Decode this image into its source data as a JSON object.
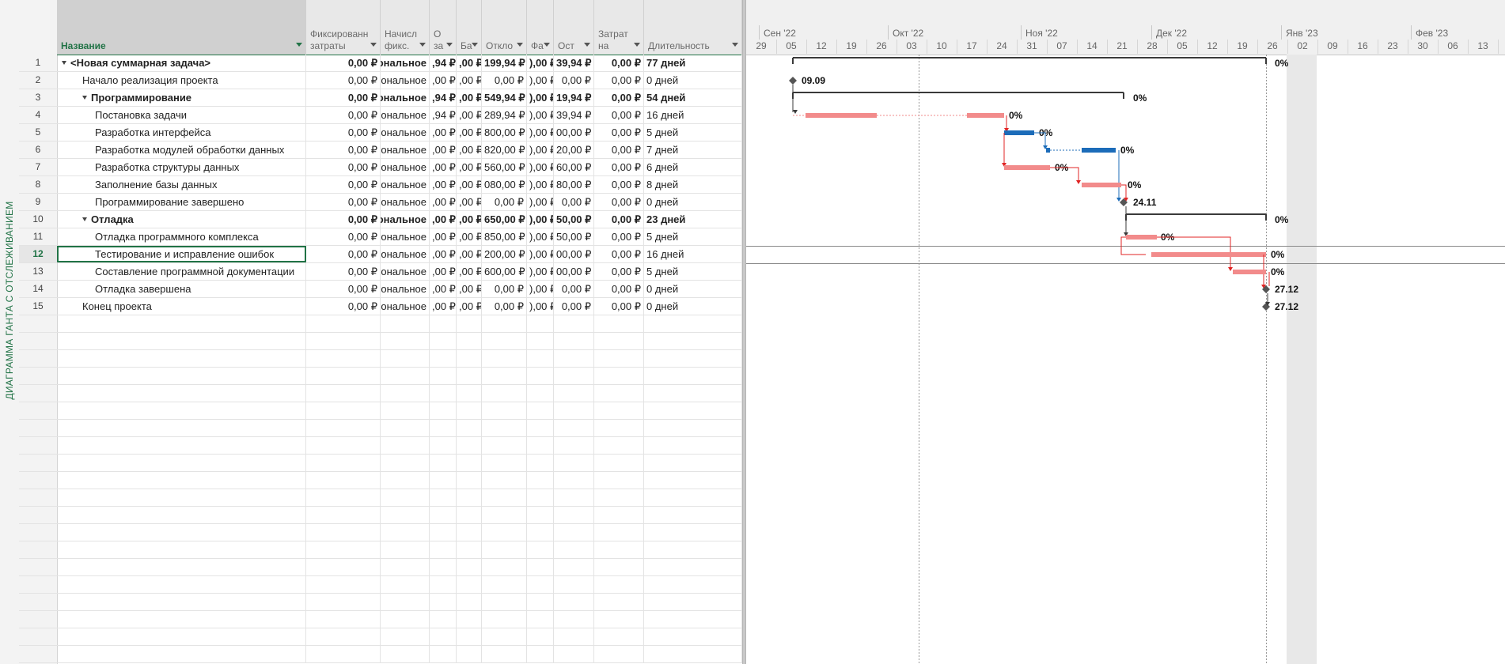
{
  "view": {
    "label": "ДИАГРАММА ГАНТА С ОТСЛЕЖИВАНИЕМ"
  },
  "table": {
    "columns": [
      {
        "key": "name",
        "l1": "",
        "l2": "Название"
      },
      {
        "key": "fixed_cost",
        "l1": "Фиксированн",
        "l2": "затраты"
      },
      {
        "key": "accrual",
        "l1": "Начисл",
        "l2": "фикс."
      },
      {
        "key": "total_cost",
        "l1": "О",
        "l2": "за"
      },
      {
        "key": "baseline",
        "l1": "",
        "l2": "Ба"
      },
      {
        "key": "variance",
        "l1": "",
        "l2": "Откло"
      },
      {
        "key": "actual",
        "l1": "",
        "l2": "Фа"
      },
      {
        "key": "remaining",
        "l1": "",
        "l2": "Ост"
      },
      {
        "key": "cost_per",
        "l1": "Затрат",
        "l2": "на"
      },
      {
        "key": "duration",
        "l1": "",
        "l2": "Длительность"
      }
    ],
    "rows": [
      {
        "id": "1",
        "name": "<Новая суммарная задача>",
        "level": 0,
        "summary": true,
        "cells": [
          "0,00 ₽",
          "ональное",
          ",94 ₽",
          ",00 ₽",
          "199,94 ₽",
          "),00 ₽",
          "39,94 ₽",
          "0,00 ₽",
          "77 дней"
        ]
      },
      {
        "id": "2",
        "name": "Начало реализация проекта",
        "level": 1,
        "summary": false,
        "cells": [
          "0,00 ₽",
          "ональное",
          ",00 ₽",
          ",00 ₽",
          "0,00 ₽",
          "),00 ₽",
          "0,00 ₽",
          "0,00 ₽",
          "0 дней"
        ]
      },
      {
        "id": "3",
        "name": "Программирование",
        "level": 1,
        "summary": true,
        "cells": [
          "0,00 ₽",
          "ональное",
          ",94 ₽",
          ",00 ₽",
          "549,94 ₽",
          "),00 ₽",
          "19,94 ₽",
          "0,00 ₽",
          "54 дней"
        ]
      },
      {
        "id": "4",
        "name": "Постановка задачи",
        "level": 2,
        "summary": false,
        "cells": [
          "0,00 ₽",
          "ональное",
          ",94 ₽",
          ",00 ₽",
          "289,94 ₽",
          "),00 ₽",
          "39,94 ₽",
          "0,00 ₽",
          "16 дней"
        ]
      },
      {
        "id": "5",
        "name": "Разработка интерфейса",
        "level": 2,
        "summary": false,
        "cells": [
          "0,00 ₽",
          "ональное",
          ",00 ₽",
          ",00 ₽",
          "800,00 ₽",
          "),00 ₽",
          "00,00 ₽",
          "0,00 ₽",
          "5 дней"
        ]
      },
      {
        "id": "6",
        "name": "Разработка модулей обработки данных",
        "level": 2,
        "summary": false,
        "cells": [
          "0,00 ₽",
          "ональное",
          ",00 ₽",
          ",00 ₽",
          "820,00 ₽",
          "),00 ₽",
          "20,00 ₽",
          "0,00 ₽",
          "7 дней"
        ]
      },
      {
        "id": "7",
        "name": "Разработка структуры данных",
        "level": 2,
        "summary": false,
        "cells": [
          "0,00 ₽",
          "ональное",
          ",00 ₽",
          ",00 ₽",
          "560,00 ₽",
          "),00 ₽",
          "60,00 ₽",
          "0,00 ₽",
          "6 дней"
        ]
      },
      {
        "id": "8",
        "name": "Заполнение базы данных",
        "level": 2,
        "summary": false,
        "cells": [
          "0,00 ₽",
          "ональное",
          ",00 ₽",
          ",00 ₽",
          "080,00 ₽",
          "),00 ₽",
          "80,00 ₽",
          "0,00 ₽",
          "8 дней"
        ]
      },
      {
        "id": "9",
        "name": "Программирование завершено",
        "level": 2,
        "summary": false,
        "cells": [
          "0,00 ₽",
          "ональное",
          ",00 ₽",
          ",00 ₽",
          "0,00 ₽",
          "),00 ₽",
          "0,00 ₽",
          "0,00 ₽",
          "0 дней"
        ]
      },
      {
        "id": "10",
        "name": "Отладка",
        "level": 1,
        "summary": true,
        "cells": [
          "0,00 ₽",
          "ональное",
          ",00 ₽",
          ",00 ₽",
          "650,00 ₽",
          "),00 ₽",
          "50,00 ₽",
          "0,00 ₽",
          "23 дней"
        ]
      },
      {
        "id": "11",
        "name": "Отладка программного комплекса",
        "level": 2,
        "summary": false,
        "cells": [
          "0,00 ₽",
          "ональное",
          ",00 ₽",
          ",00 ₽",
          "850,00 ₽",
          "),00 ₽",
          "50,00 ₽",
          "0,00 ₽",
          "5 дней"
        ]
      },
      {
        "id": "12",
        "name": "Тестирование и исправление ошибок",
        "level": 2,
        "summary": false,
        "cells": [
          "0,00 ₽",
          "ональное",
          ",00 ₽",
          ",00 ₽",
          "200,00 ₽",
          "),00 ₽",
          "00,00 ₽",
          "0,00 ₽",
          "16 дней"
        ]
      },
      {
        "id": "13",
        "name": "Составление программной документации",
        "level": 2,
        "summary": false,
        "cells": [
          "0,00 ₽",
          "ональное",
          ",00 ₽",
          ",00 ₽",
          "600,00 ₽",
          "),00 ₽",
          "00,00 ₽",
          "0,00 ₽",
          "5 дней"
        ]
      },
      {
        "id": "14",
        "name": "Отладка завершена",
        "level": 2,
        "summary": false,
        "cells": [
          "0,00 ₽",
          "ональное",
          ",00 ₽",
          ",00 ₽",
          "0,00 ₽",
          "),00 ₽",
          "0,00 ₽",
          "0,00 ₽",
          "0 дней"
        ]
      },
      {
        "id": "15",
        "name": "Конец проекта",
        "level": 1,
        "summary": false,
        "cells": [
          "0,00 ₽",
          "ональное",
          ",00 ₽",
          ",00 ₽",
          "0,00 ₽",
          "),00 ₽",
          "0,00 ₽",
          "0,00 ₽",
          "0 дней"
        ]
      }
    ],
    "selected_row": "12"
  },
  "timescale": {
    "months": [
      "Сен '22",
      "Окт '22",
      "Ноя '22",
      "Дек '22",
      "Янв '23",
      "Фев '23"
    ],
    "weeks": [
      "29",
      "05",
      "12",
      "19",
      "26",
      "03",
      "10",
      "17",
      "24",
      "31",
      "07",
      "14",
      "21",
      "28",
      "05",
      "12",
      "19",
      "26",
      "02",
      "09",
      "16",
      "23",
      "30",
      "06",
      "13"
    ]
  },
  "gantt": {
    "bar_labels": [
      "0%",
      "09.09",
      "0%",
      "0%",
      "0%",
      "0%",
      "0%",
      "0%",
      "24.11",
      "0%",
      "0%",
      "0%",
      "0%",
      "27.12",
      "27.12"
    ],
    "colors": {
      "critical": "#f28b8b",
      "normal": "#1c6cb9",
      "summary": "#3a3a3a",
      "critical_link": "#e02424",
      "normal_link": "#1c6cb9",
      "weekend": "#e8e8e8"
    }
  }
}
